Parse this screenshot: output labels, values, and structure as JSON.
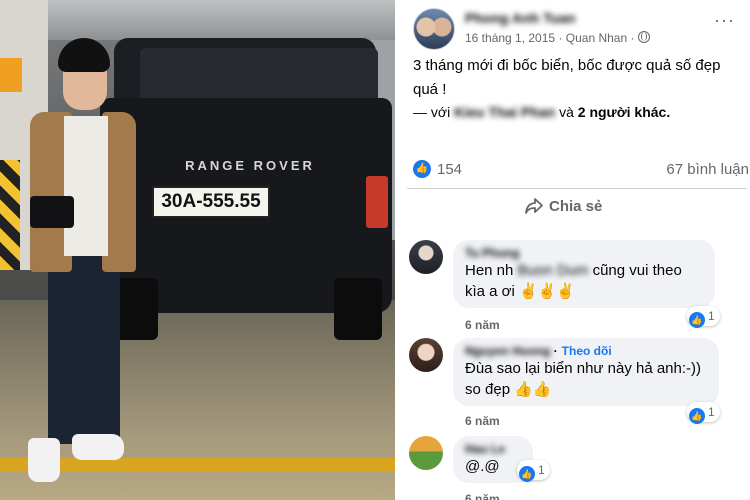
{
  "photo": {
    "car_brand": "RANGE ROVER",
    "plate": "30A-555.55"
  },
  "post": {
    "author": "Phong Anh Tuan",
    "date": "16 tháng 1, 2015",
    "separator": "·",
    "location": "Quan Nhan",
    "text": "3 tháng mới đi bốc biển, bốc được quả số đẹp quá !",
    "tag_prefix": "— với",
    "tagged_name": "Kieu Thai Phan",
    "tag_conj": "và",
    "tag_others": "2 người khác.",
    "reaction_count": "154",
    "comment_count": "67 bình luận",
    "share_label": "Chia sẻ"
  },
  "comments": [
    {
      "name": "Tu Phung",
      "text_start": "Hen nh",
      "text_blur": "Buon Dum",
      "text_end": "cũng vui theo kìa a ơi ✌✌✌",
      "time": "6 năm",
      "reactions": "1"
    },
    {
      "name": "Nguyen Huong",
      "follow": "Theo dõi",
      "text": "Đùa sao lại biển như này hả anh:-)) so đẹp 👍👍",
      "time": "6 năm",
      "reactions": "1"
    },
    {
      "name": "Hau Le",
      "text": "@.@",
      "time": "6 năm",
      "reactions": "1"
    }
  ],
  "colors": {
    "facebook_blue": "#1877f2",
    "meta_gray": "#65676b",
    "bubble_bg": "#f0f2f5"
  },
  "icons": [
    "globe-icon",
    "more-icon",
    "like-icon",
    "share-icon"
  ]
}
